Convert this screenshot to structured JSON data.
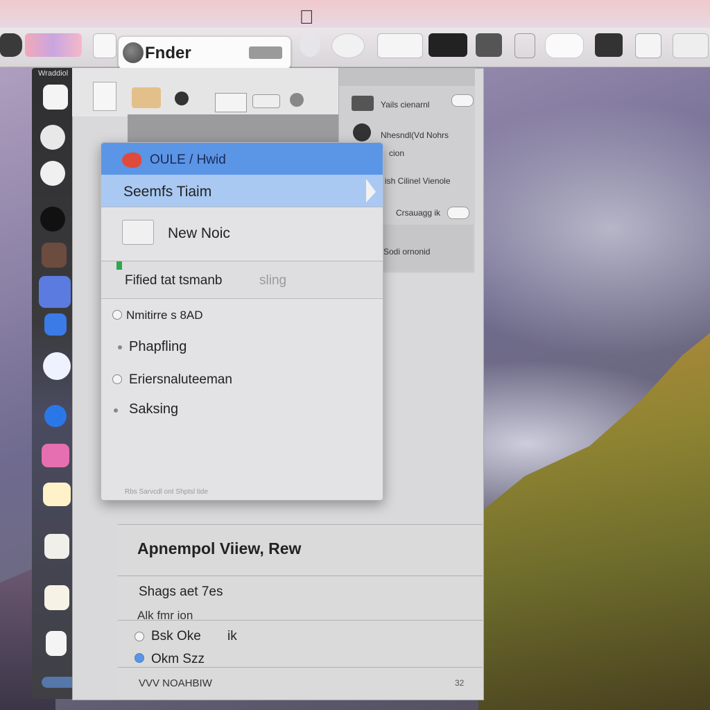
{
  "toolbar": {
    "search_label": "Fnder",
    "items": [
      "app-icon-1",
      "app-icon-2",
      "app-icon-3"
    ]
  },
  "dock": {
    "title": "Wraddiol"
  },
  "right_panel": {
    "row1": "Yails cienarnl",
    "row2": "Nhesndl(Vd Nohrs",
    "row2b": "cion",
    "row3": "ish Cilinel Vienole",
    "row4": "Crsauagg ik",
    "row5": "Sodi ornonid"
  },
  "menu": {
    "header": "OULE / Hwid",
    "highlighted": "Seemfs Tiaim",
    "new_item": "New Noic",
    "pinned": "Fified tat tsmanb",
    "pinned_suffix": "sling",
    "option1": "Nmitirre s 8AD",
    "option2": "Phapfling",
    "option3": "Eriersnaluteeman",
    "option4": "Saksing",
    "footer": "Rbs Sarvcdl ont Shptsl tide"
  },
  "bottom_panel": {
    "title": "Apnempol Viiew, Rew",
    "section": "Shags aet 7es",
    "subsection": "Alk fmr ion",
    "radio1": "Bsk Oke",
    "radio1_suffix": "ik",
    "radio2": "Okm Szz",
    "footer": "VVV NOAHBIW",
    "footer_right": "32"
  },
  "colors": {
    "menu_selected_blue": "#5b95e6",
    "menu_highlight_lightblue": "#a9c9f2",
    "dock_bg": "#2f2f31"
  }
}
